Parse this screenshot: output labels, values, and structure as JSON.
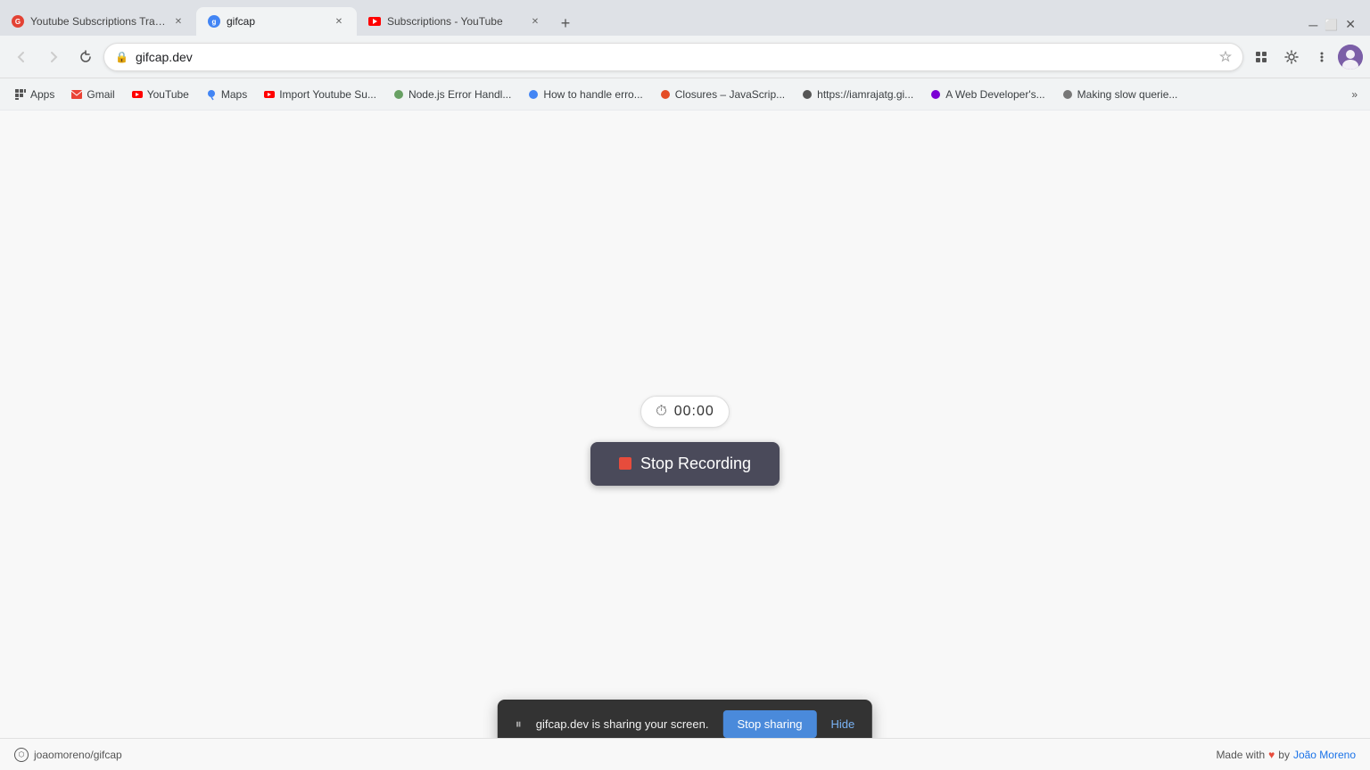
{
  "window": {
    "title": "gifcap.dev"
  },
  "tabs": [
    {
      "id": "tab1",
      "title": "Youtube Subscriptions Transfer",
      "url": "chrome-extension://...",
      "favicon_color": "#e34234",
      "active": false,
      "favicon_type": "extension"
    },
    {
      "id": "tab2",
      "title": "gifcap",
      "url": "gifcap.dev",
      "favicon_color": "#4285f4",
      "active": true,
      "favicon_type": "g"
    },
    {
      "id": "tab3",
      "title": "Subscriptions - YouTube",
      "url": "youtube.com",
      "favicon_color": "#ff0000",
      "active": false,
      "favicon_type": "yt"
    }
  ],
  "toolbar": {
    "address": "gifcap.dev"
  },
  "bookmarks": [
    {
      "label": "Apps",
      "type": "apps"
    },
    {
      "label": "Gmail",
      "favicon_color": "#ea4335"
    },
    {
      "label": "YouTube",
      "favicon_color": "#ff0000"
    },
    {
      "label": "Maps",
      "favicon_color": "#4285f4"
    },
    {
      "label": "Import Youtube Su...",
      "favicon_color": "#ff0000"
    },
    {
      "label": "Node.js Error Handl...",
      "favicon_color": "#68a063"
    },
    {
      "label": "How to handle erro...",
      "favicon_color": "#4285f4"
    },
    {
      "label": "Closures – JavaScrip...",
      "favicon_color": "#e44d26"
    },
    {
      "label": "https://iamrajatg.gi...",
      "favicon_color": "#333"
    },
    {
      "label": "A Web Developer's...",
      "favicon_color": "#7b00d4"
    },
    {
      "label": "Making slow querie...",
      "favicon_color": "#555"
    }
  ],
  "recording": {
    "timer": "00:00",
    "stop_button_label": "Stop Recording"
  },
  "sharing_bar": {
    "text": "gifcap.dev is sharing your screen.",
    "stop_sharing_label": "Stop sharing",
    "hide_label": "Hide"
  },
  "footer": {
    "repo_label": "joaomoreno/gifcap",
    "made_with_label": "Made with",
    "author_label": "João Moreno"
  }
}
